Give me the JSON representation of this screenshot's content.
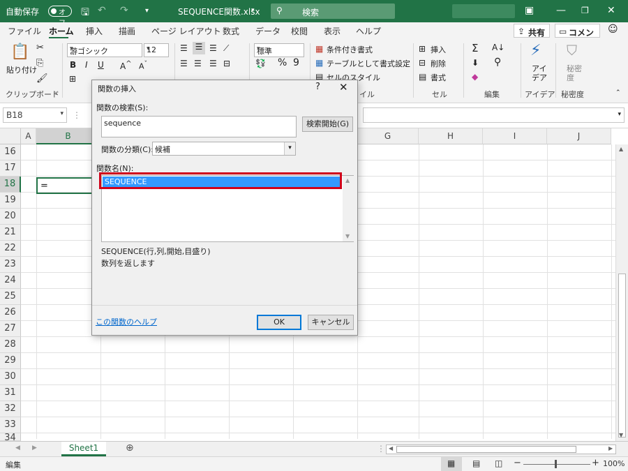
{
  "titlebar": {
    "autosave_label": "自動保存",
    "autosave_state": "オフ",
    "file_title": "SEQUENCE関数.xlsx",
    "search_placeholder": "検索"
  },
  "tabs": [
    "ファイル",
    "ホーム",
    "挿入",
    "描画",
    "ページ レイアウト",
    "数式",
    "データ",
    "校閲",
    "表示",
    "ヘルプ"
  ],
  "active_tab": "ホーム",
  "share_label": "共有",
  "comment_label": "コメント",
  "ribbon": {
    "paste_label": "貼り付け",
    "clipboard_group": "クリップボード",
    "font_name": "游ゴシック",
    "font_size": "12",
    "number_format": "標準",
    "conditional_format": "条件付き書式",
    "format_as_table": "テーブルとして書式設定",
    "cell_styles": "セルのスタイル",
    "styles_group": "イル",
    "insert_label": "挿入",
    "delete_label": "削除",
    "format_label": "書式",
    "cells_group": "セル",
    "editing_group": "編集",
    "ideas_label": "アイ\nデア",
    "ideas_group": "アイデア",
    "sensitivity_label": "秘密\n度",
    "sensitivity_group": "秘密度"
  },
  "namebox": "B18",
  "columns": [
    "A",
    "B",
    "G",
    "H",
    "I",
    "J"
  ],
  "rows": [
    "16",
    "17",
    "18",
    "19",
    "20",
    "21",
    "22",
    "23",
    "24",
    "25",
    "26",
    "27",
    "28",
    "29",
    "30",
    "31",
    "32",
    "33",
    "34"
  ],
  "cell_b18": "=",
  "sheet_tab": "Sheet1",
  "status": {
    "mode": "編集",
    "zoom": "100%"
  },
  "dialog": {
    "title": "関数の挿入",
    "search_label": "関数の検索(S):",
    "search_value": "sequence",
    "search_button": "検索開始(G)",
    "category_label": "関数の分類(C):",
    "category_value": "候補",
    "function_list_label": "関数名(N):",
    "selected_function": "SEQUENCE",
    "syntax": "SEQUENCE(行,列,開始,目盛り)",
    "description": "数列を返します",
    "help_link": "この関数のヘルプ",
    "ok_button": "OK",
    "cancel_button": "キャンセル"
  },
  "colors": {
    "excel_green": "#217346",
    "selection_blue": "#3399ff",
    "highlight_red": "#d0021b"
  }
}
